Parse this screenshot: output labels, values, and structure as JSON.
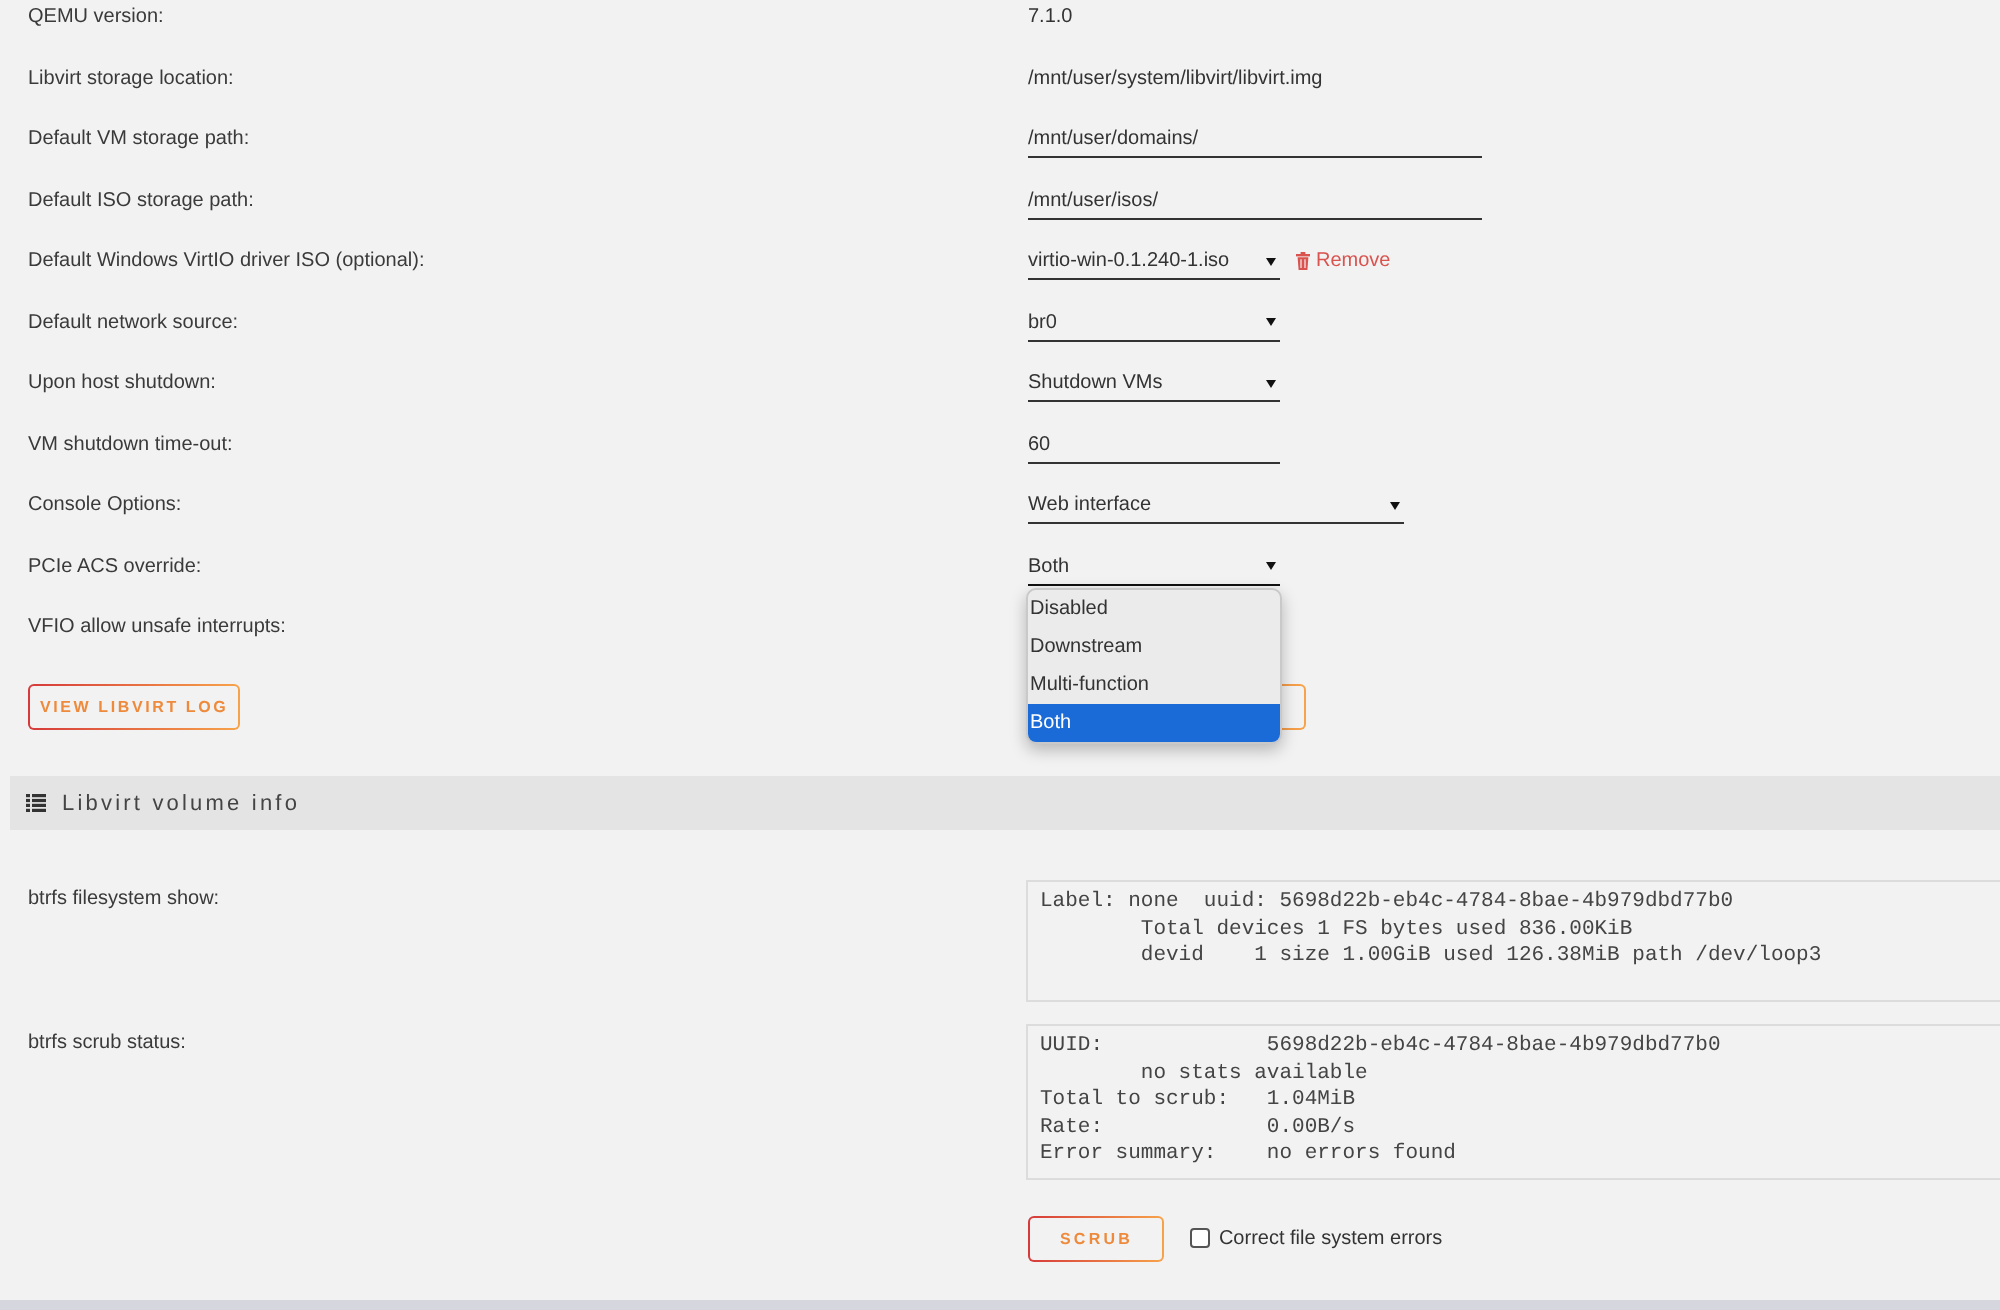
{
  "settings": [
    {
      "label": "QEMU version:",
      "kind": "text",
      "value": "7.1.0"
    },
    {
      "label": "Libvirt storage location:",
      "kind": "text",
      "value": "/mnt/user/system/libvirt/libvirt.img"
    },
    {
      "label": "Default VM storage path:",
      "kind": "input",
      "value": "/mnt/user/domains/"
    },
    {
      "label": "Default ISO storage path:",
      "kind": "input",
      "value": "/mnt/user/isos/"
    },
    {
      "label": "Default Windows VirtIO driver ISO (optional):",
      "kind": "select",
      "value": "virtio-win-0.1.240-1.iso",
      "expanded": false,
      "remove": "Remove"
    },
    {
      "label": "Default network source:",
      "kind": "select",
      "value": "br0",
      "expanded": false
    },
    {
      "label": "Upon host shutdown:",
      "kind": "select",
      "value": "Shutdown VMs",
      "expanded": false
    },
    {
      "label": "VM shutdown time-out:",
      "kind": "number",
      "value": "60"
    },
    {
      "label": "Console Options:",
      "kind": "wide_select",
      "value": "Web interface",
      "expanded": false
    },
    {
      "label": "PCIe ACS override:",
      "kind": "select",
      "value": "Both",
      "expanded": true,
      "options": [
        {
          "label": "Disabled",
          "selected": false
        },
        {
          "label": "Downstream",
          "selected": false
        },
        {
          "label": "Multi-function",
          "selected": false
        },
        {
          "label": "Both",
          "selected": true
        }
      ]
    },
    {
      "label": "VFIO allow unsafe interrupts:",
      "kind": "label"
    }
  ],
  "view_log_button": "VIEW LIBVIRT LOG",
  "volume_info": {
    "title": "Libvirt volume info",
    "rows": [
      {
        "label": "btrfs filesystem show:",
        "output": "Label: none  uuid: 5698d22b-eb4c-4784-8bae-4b979dbd77b0\n        Total devices 1 FS bytes used 836.00KiB\n        devid    1 size 1.00GiB used 126.38MiB path /dev/loop3"
      },
      {
        "label": "btrfs scrub status:",
        "output": "UUID:             5698d22b-eb4c-4784-8bae-4b979dbd77b0\n        no stats available\nTotal to scrub:   1.04MiB\nRate:             0.00B/s\nError summary:    no errors found"
      }
    ]
  },
  "scrub_button": "SCRUB",
  "correct_errors": {
    "label": "Correct file system errors",
    "checked": false
  }
}
